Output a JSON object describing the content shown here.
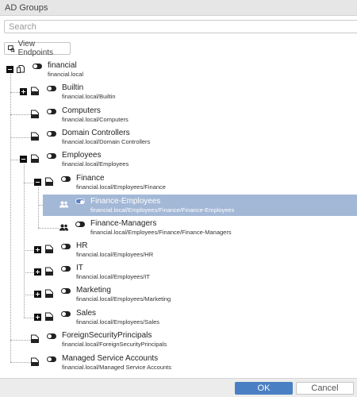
{
  "window": {
    "title": "AD Groups"
  },
  "search": {
    "placeholder": "Search"
  },
  "toolbar": {
    "view_endpoints_label": "View Endpoints",
    "view_endpoints_icon": "endpoint-icon"
  },
  "tree": {
    "nodes": [
      {
        "name": "financial",
        "path": "financial.local",
        "expander": "minus",
        "icon": "domain-icon",
        "toggle": "off"
      },
      {
        "name": "Builtin",
        "path": "financial.local/Builtin",
        "expander": "plus",
        "icon": "folder-icon",
        "toggle": "off"
      },
      {
        "name": "Computers",
        "path": "financial.local/Computers",
        "expander": "none",
        "icon": "folder-icon",
        "toggle": "off"
      },
      {
        "name": "Domain Controllers",
        "path": "financial.local/Domain Controllers",
        "expander": "none",
        "icon": "folder-icon",
        "toggle": "off"
      },
      {
        "name": "Employees",
        "path": "financial.local/Employees",
        "expander": "minus",
        "icon": "folder-icon",
        "toggle": "off"
      },
      {
        "name": "Finance",
        "path": "financial.local/Employees/Finance",
        "expander": "minus",
        "icon": "folder-icon",
        "toggle": "off"
      },
      {
        "name": "Finance-Employees",
        "path": "financial.local/Employees/Finance/Finance-Employees",
        "expander": "none",
        "icon": "group-icon",
        "toggle": "on",
        "selected": true
      },
      {
        "name": "Finance-Managers",
        "path": "financial.local/Employees/Finance/Finance-Managers",
        "expander": "none",
        "icon": "group-icon",
        "toggle": "off"
      },
      {
        "name": "HR",
        "path": "financial.local/Employees/HR",
        "expander": "plus",
        "icon": "folder-icon",
        "toggle": "off"
      },
      {
        "name": "IT",
        "path": "financial.local/Employees/IT",
        "expander": "plus",
        "icon": "folder-icon",
        "toggle": "off"
      },
      {
        "name": "Marketing",
        "path": "financial.local/Employees/Marketing",
        "expander": "plus",
        "icon": "folder-icon",
        "toggle": "off"
      },
      {
        "name": "Sales",
        "path": "financial.local/Employees/Sales",
        "expander": "plus",
        "icon": "folder-icon",
        "toggle": "off"
      },
      {
        "name": "ForeignSecurityPrincipals",
        "path": "financial.local/ForeignSecurityPrincipals",
        "expander": "none",
        "icon": "folder-icon",
        "toggle": "off"
      },
      {
        "name": "Managed Service Accounts",
        "path": "financial.local/Managed Service Accounts",
        "expander": "none",
        "icon": "folder-icon",
        "toggle": "off"
      }
    ]
  },
  "footer": {
    "ok_label": "OK",
    "cancel_label": "Cancel"
  },
  "colors": {
    "accent": "#4a7fc3",
    "selection": "#a3b8d6",
    "toggle_on": "#5b7fbf"
  }
}
